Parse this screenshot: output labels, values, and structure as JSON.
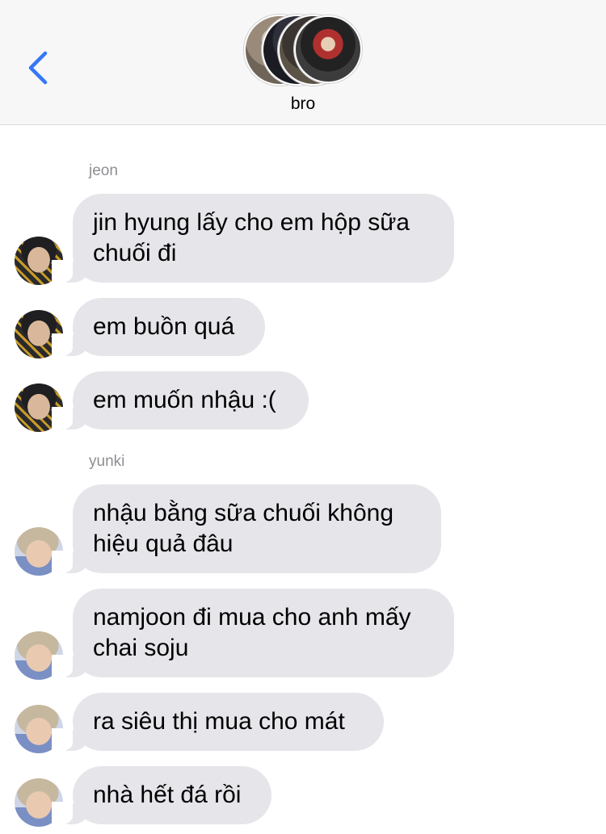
{
  "header": {
    "title": "bro",
    "back_icon": "chevron-left-icon",
    "accent_color": "#3478f6"
  },
  "colors": {
    "bubble": "#e5e5ea",
    "sender_name": "#8e8e93"
  },
  "messages": [
    {
      "sender": "jeon",
      "text": "jin hyung lấy cho em hộp sữa\nchuối đi"
    },
    {
      "sender": "jeon",
      "text": "em buồn quá"
    },
    {
      "sender": "jeon",
      "text": "em muốn nhậu :("
    },
    {
      "sender": "yunki",
      "text": "nhậu bằng sữa chuối không\nhiệu quả đâu"
    },
    {
      "sender": "yunki",
      "text": "namjoon đi mua cho anh mấy\nchai soju"
    },
    {
      "sender": "yunki",
      "text": "ra siêu thị mua cho mát"
    },
    {
      "sender": "yunki",
      "text": "nhà hết đá rồi"
    }
  ],
  "groups": [
    {
      "name": "jeon"
    },
    {
      "name": "yunki"
    }
  ]
}
